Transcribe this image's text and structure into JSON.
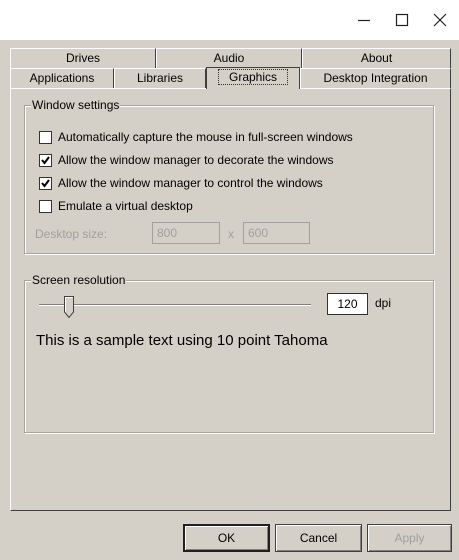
{
  "titlebar": {
    "minimize_icon": "minimize-icon",
    "maximize_icon": "maximize-icon",
    "close_icon": "close-icon"
  },
  "tabs": {
    "row_back": [
      "Drives",
      "Audio",
      "About"
    ],
    "row_front": [
      "Applications",
      "Libraries",
      "Graphics",
      "Desktop Integration"
    ],
    "active": "Graphics"
  },
  "window_settings": {
    "title": "Window settings",
    "options": [
      {
        "label": "Automatically capture the mouse in full-screen windows",
        "checked": false
      },
      {
        "label": "Allow the window manager to decorate the windows",
        "checked": true
      },
      {
        "label": "Allow the window manager to control the windows",
        "checked": true
      },
      {
        "label": "Emulate a virtual desktop",
        "checked": false
      }
    ],
    "desktop_size_label": "Desktop size:",
    "desktop_width": "800",
    "desktop_separator": "x",
    "desktop_height": "600"
  },
  "screen_resolution": {
    "title": "Screen resolution",
    "dpi_value": "120",
    "dpi_unit": "dpi",
    "slider_fraction": 0.12,
    "sample_text": "This is a sample text using 10 point Tahoma"
  },
  "buttons": {
    "ok": "OK",
    "cancel": "Cancel",
    "apply": "Apply"
  }
}
